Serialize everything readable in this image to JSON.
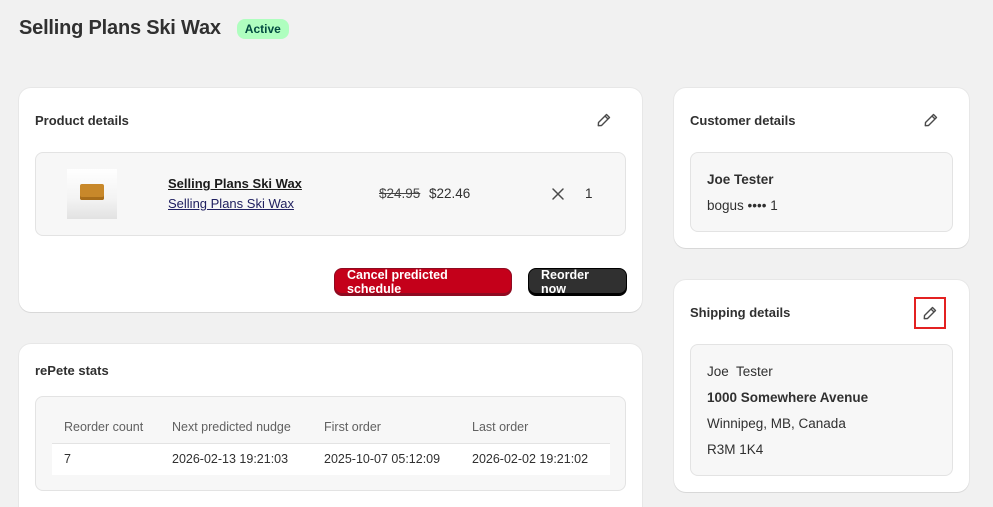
{
  "header": {
    "title": "Selling Plans Ski Wax",
    "status": "Active"
  },
  "product_details": {
    "title": "Product details",
    "item": {
      "name": "Selling Plans Ski Wax",
      "variant": "Selling Plans Ski Wax",
      "price_original": "$24.95",
      "price_current": "$22.46",
      "quantity": "1"
    },
    "cancel_label": "Cancel predicted schedule",
    "reorder_label": "Reorder now"
  },
  "stats": {
    "title": "rePete stats",
    "columns": [
      "Reorder count",
      "Next predicted nudge",
      "First order",
      "Last order"
    ],
    "rows": [
      [
        "7",
        "2026-02-13 19:21:03",
        "2025-10-07 05:12:09",
        "2026-02-02 19:21:02"
      ]
    ]
  },
  "customer_details": {
    "title": "Customer details",
    "name": "Joe Tester",
    "payment": "bogus •••• 1"
  },
  "shipping_details": {
    "title": "Shipping details",
    "name": "Joe  Tester",
    "address1": "1000 Somewhere Avenue",
    "city_line": "Winnipeg, MB, Canada",
    "postal": "R3M 1K4"
  },
  "icons": {
    "edit": "pencil-icon",
    "quantity": "times-icon"
  },
  "colors": {
    "badge_bg": "#affebf",
    "cancel_button": "#c4001a",
    "reorder_button": "#303030",
    "highlight": "#e32121"
  }
}
